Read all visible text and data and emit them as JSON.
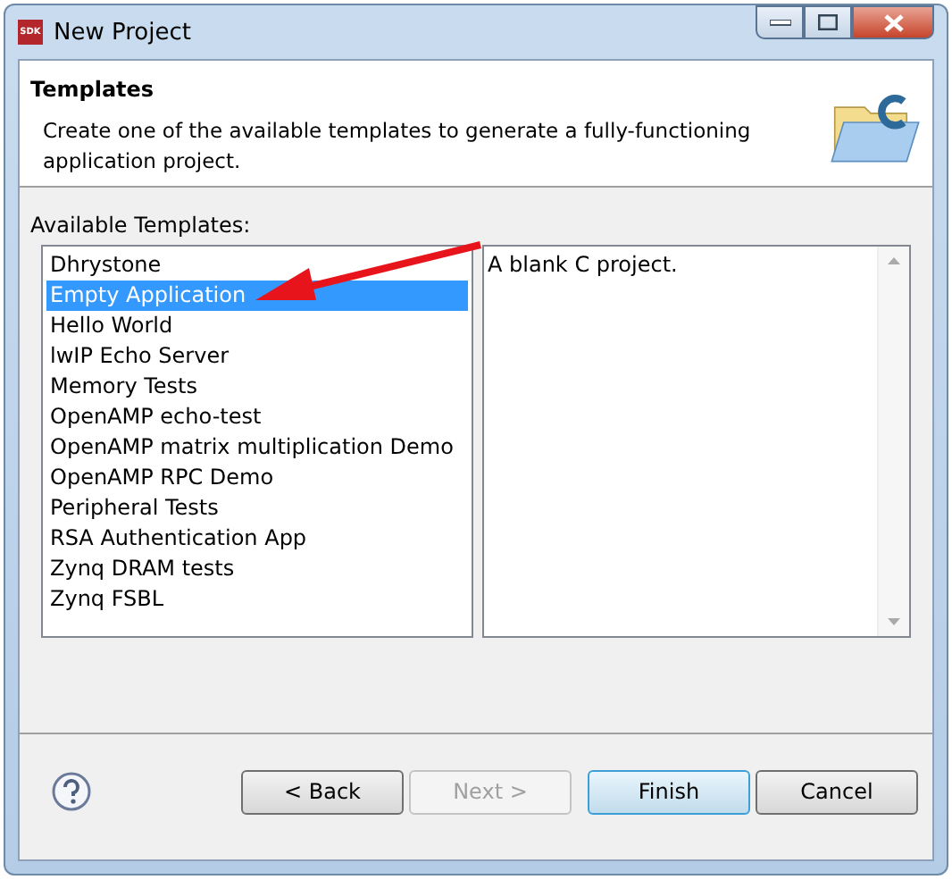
{
  "window": {
    "title": "New Project",
    "icon_text": "SDK"
  },
  "header": {
    "title": "Templates",
    "description": "Create one of the available templates to generate a fully-functioning application project."
  },
  "templates_label": "Available Templates:",
  "templates": [
    {
      "label": "Dhrystone",
      "selected": false
    },
    {
      "label": "Empty Application",
      "selected": true
    },
    {
      "label": "Hello World",
      "selected": false
    },
    {
      "label": "lwIP Echo Server",
      "selected": false
    },
    {
      "label": "Memory Tests",
      "selected": false
    },
    {
      "label": "OpenAMP echo-test",
      "selected": false
    },
    {
      "label": "OpenAMP matrix multiplication Demo",
      "selected": false
    },
    {
      "label": "OpenAMP RPC Demo",
      "selected": false
    },
    {
      "label": "Peripheral Tests",
      "selected": false
    },
    {
      "label": "RSA Authentication App",
      "selected": false
    },
    {
      "label": "Zynq DRAM tests",
      "selected": false
    },
    {
      "label": "Zynq FSBL",
      "selected": false
    }
  ],
  "description_text": "A blank C project.",
  "buttons": [
    {
      "label": "< Back",
      "disabled": false,
      "default": false
    },
    {
      "label": "Next >",
      "disabled": true,
      "default": false
    },
    {
      "label": "Finish",
      "disabled": false,
      "default": true
    },
    {
      "label": "Cancel",
      "disabled": false,
      "default": false
    }
  ]
}
